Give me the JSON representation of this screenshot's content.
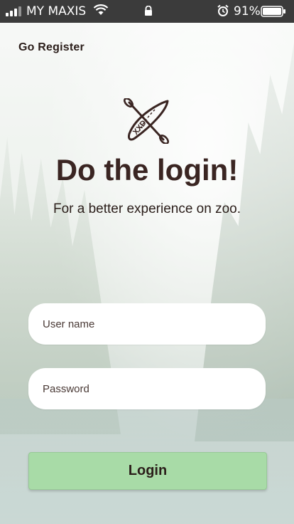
{
  "status_bar": {
    "carrier": "MY MAXIS",
    "battery_percent": "91%",
    "icons": [
      "signal-icon",
      "wifi-icon",
      "lock-icon",
      "alarm-icon",
      "battery-icon"
    ]
  },
  "nav": {
    "register_link": "Go Register"
  },
  "header": {
    "logo_icon": "kayak-paddle-icon",
    "title": "Do the login!",
    "subtitle": "For a better experience on zoo."
  },
  "form": {
    "username_placeholder": "User name",
    "username_value": "",
    "password_placeholder": "Password",
    "password_value": "",
    "login_label": "Login"
  },
  "colors": {
    "text_dark": "#2b1e1a",
    "title": "#3a2522",
    "button_bg": "#a8dba7",
    "statusbar_bg": "#3b3b3b"
  }
}
